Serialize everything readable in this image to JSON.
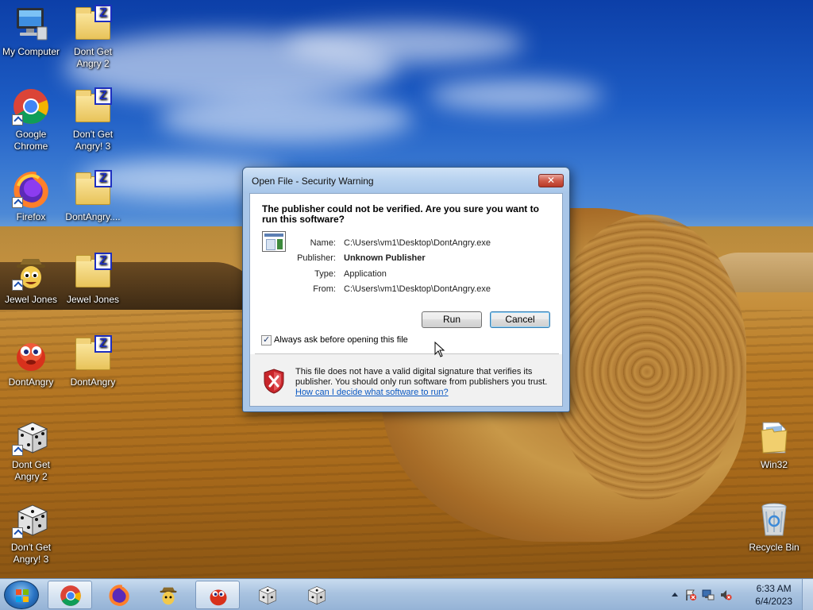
{
  "desktop": {
    "icons": [
      {
        "label": "My Computer",
        "icon": "computer-icon"
      },
      {
        "label": "Dont Get Angry 2",
        "icon": "folder-zip-icon"
      },
      {
        "label": "Google Chrome",
        "icon": "chrome-icon"
      },
      {
        "label": "Don't Get Angry! 3",
        "icon": "folder-zip-icon"
      },
      {
        "label": "Firefox",
        "icon": "firefox-icon"
      },
      {
        "label": "DontAngry....",
        "icon": "folder-zip-icon"
      },
      {
        "label": "Jewel Jones",
        "icon": "jewel-jones-icon"
      },
      {
        "label": "Jewel Jones",
        "icon": "folder-zip-icon"
      },
      {
        "label": "DontAngry",
        "icon": "dontangry-game-icon"
      },
      {
        "label": "DontAngry",
        "icon": "folder-zip-icon"
      },
      {
        "label": "Dont Get Angry 2",
        "icon": "dice-icon"
      },
      {
        "label": "Don't Get Angry! 3",
        "icon": "dice-icon"
      },
      {
        "label": "Win32",
        "icon": "folder-icon"
      },
      {
        "label": "Recycle Bin",
        "icon": "recycle-bin-icon"
      }
    ]
  },
  "dialog": {
    "title": "Open File - Security Warning",
    "close_label": "✕",
    "heading": "The publisher could not be verified.  Are you sure you want to run this software?",
    "fields": [
      {
        "label": "Name:",
        "value": "C:\\Users\\vm1\\Desktop\\DontAngry.exe"
      },
      {
        "label": "Publisher:",
        "value": "Unknown Publisher"
      },
      {
        "label": "Type:",
        "value": "Application"
      },
      {
        "label": "From:",
        "value": "C:\\Users\\vm1\\Desktop\\DontAngry.exe"
      }
    ],
    "run_label": "Run",
    "cancel_label": "Cancel",
    "checkbox_label": "Always ask before opening this file",
    "checkbox_checked": true,
    "footer_text": "This file does not have a valid digital signature that verifies its publisher.  You should only run software from publishers you trust.",
    "footer_link": "How can I decide what software to run?"
  },
  "taskbar": {
    "items": [
      {
        "icon": "chrome-icon",
        "active": true
      },
      {
        "icon": "firefox-icon",
        "active": false
      },
      {
        "icon": "jewel-jones-icon",
        "active": false
      },
      {
        "icon": "dontangry-game-icon",
        "active": true
      },
      {
        "icon": "dice-icon",
        "active": false
      },
      {
        "icon": "dice-icon",
        "active": false
      }
    ],
    "clock_time": "6:33 AM",
    "clock_date": "6/4/2023"
  }
}
